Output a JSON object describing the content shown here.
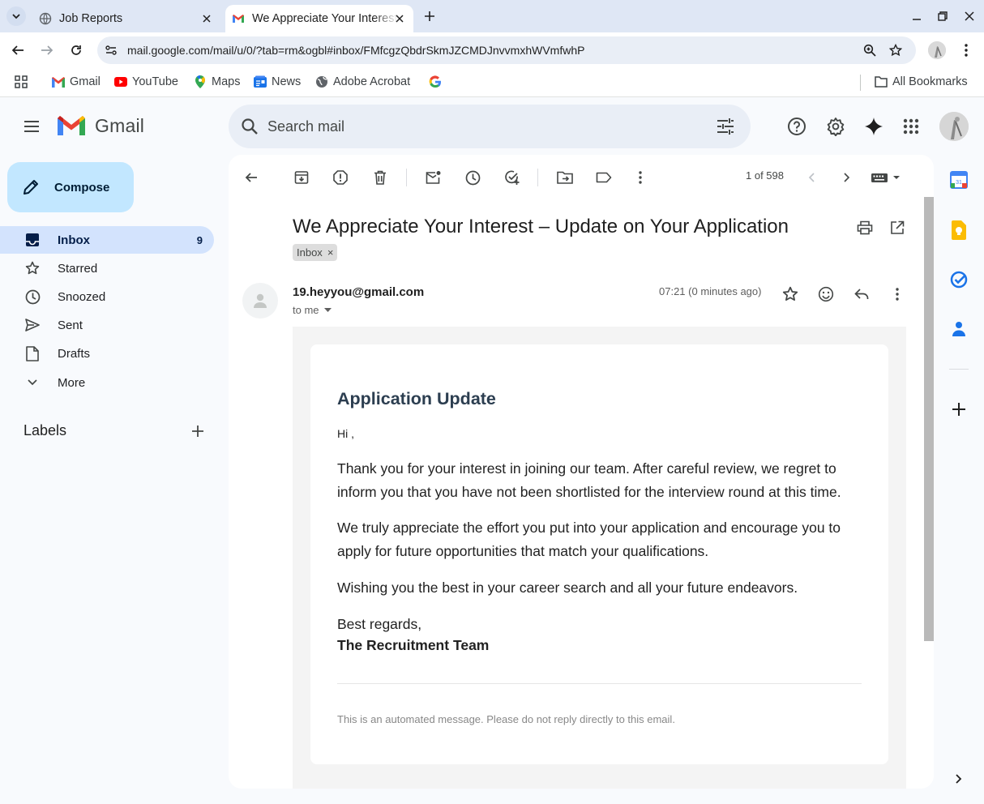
{
  "browser": {
    "tabs": [
      {
        "title": "Job Reports",
        "icon": "globe-icon",
        "active": false
      },
      {
        "title": "We Appreciate Your Interest – Update on Your Application",
        "icon": "gmail-icon",
        "active": true
      }
    ],
    "url": "mail.google.com/mail/u/0/?tab=rm&ogbl#inbox/FMfcgzQbdrSkmJZCMDJnvvmxhWVmfwhP",
    "bookmarks": [
      {
        "label": "Gmail",
        "icon": "gmail-icon"
      },
      {
        "label": "YouTube",
        "icon": "youtube-icon"
      },
      {
        "label": "Maps",
        "icon": "maps-icon"
      },
      {
        "label": "News",
        "icon": "news-icon"
      },
      {
        "label": "Adobe Acrobat",
        "icon": "globe-icon"
      },
      {
        "label": "",
        "icon": "google-icon"
      }
    ],
    "all_bookmarks": "All Bookmarks"
  },
  "gmail": {
    "brand": "Gmail",
    "search_placeholder": "Search mail",
    "compose": "Compose",
    "nav": [
      {
        "label": "Inbox",
        "count": "9",
        "icon": "inbox-icon",
        "active": true
      },
      {
        "label": "Starred",
        "count": "",
        "icon": "star-icon"
      },
      {
        "label": "Snoozed",
        "count": "",
        "icon": "clock-icon"
      },
      {
        "label": "Sent",
        "count": "",
        "icon": "send-icon"
      },
      {
        "label": "Drafts",
        "count": "",
        "icon": "draft-icon"
      },
      {
        "label": "More",
        "count": "",
        "icon": "chevron-down-icon"
      }
    ],
    "labels_heading": "Labels",
    "pager": "1 of 598",
    "email": {
      "subject": "We Appreciate Your Interest – Update on Your Application",
      "label_chip": "Inbox",
      "sender": "19.heyyou@gmail.com",
      "to": "to me",
      "time": "07:21 (0 minutes ago)",
      "heading": "Application Update",
      "greeting": "Hi ,",
      "paragraphs": [
        "Thank you for your interest in joining our team. After careful review, we regret to inform you that you have not been shortlisted for the interview round at this time.",
        "We truly appreciate the effort you put into your application and encourage you to apply for future opportunities that match your qualifications.",
        "Wishing you the best in your career search and all your future endeavors."
      ],
      "closing": "Best regards,",
      "signature": "The Recruitment Team",
      "footer": "This is an automated message. Please do not reply directly to this email."
    }
  },
  "colors": {
    "accent": "#0b57d0",
    "nav_active": "#d3e3fd",
    "compose_bg": "#c2e7ff",
    "heading": "#2c3e50"
  }
}
